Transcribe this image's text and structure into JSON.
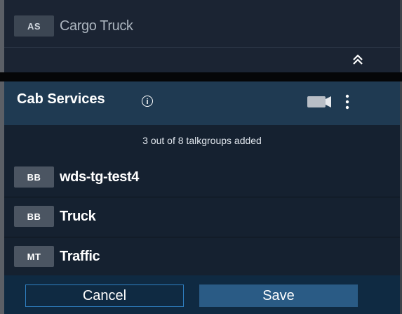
{
  "previous_group": {
    "item": {
      "badge": "AS",
      "name": "Cargo Truck"
    }
  },
  "group": {
    "title": "Cab Services",
    "count_text": "3 out of 8 talkgroups added",
    "talkgroups": [
      {
        "badge": "BB",
        "name": "wds-tg-test4"
      },
      {
        "badge": "BB",
        "name": "Truck"
      },
      {
        "badge": "MT",
        "name": "Traffic"
      }
    ]
  },
  "footer": {
    "cancel_label": "Cancel",
    "save_label": "Save"
  },
  "colors": {
    "header_bg": "#1f3a52",
    "body_bg": "#152130",
    "badge_bg": "#4b5562",
    "save_bg": "#2a5b85",
    "cancel_border": "#2f7fc0"
  },
  "icons": {
    "collapse": "double-chevron-up-icon",
    "info": "info-icon",
    "video": "video-camera-icon",
    "menu": "kebab-menu-icon"
  }
}
